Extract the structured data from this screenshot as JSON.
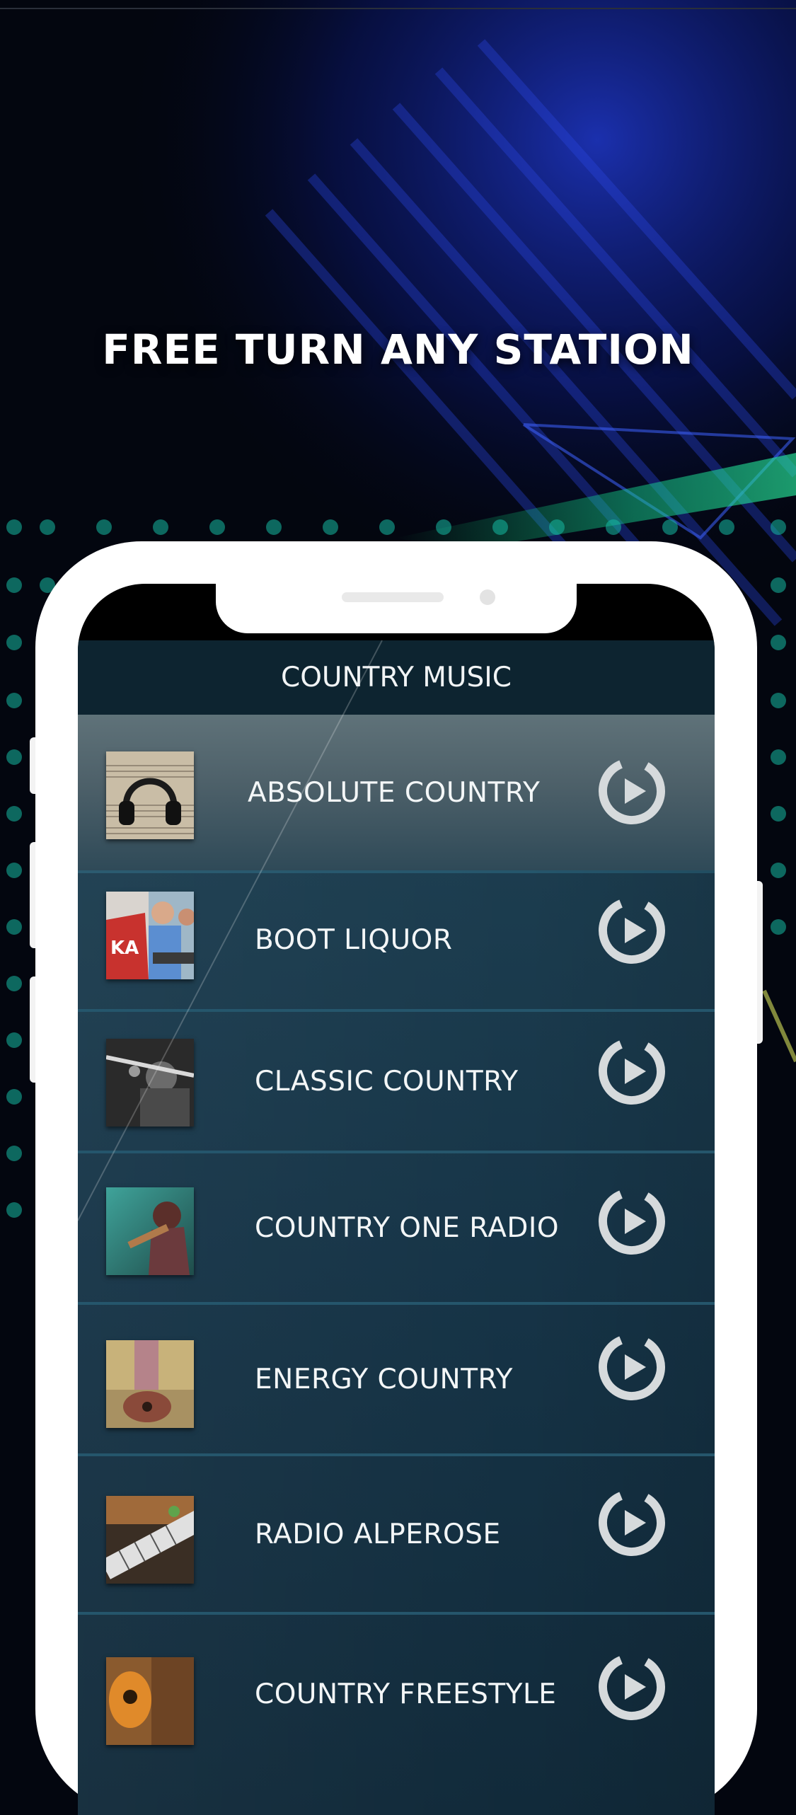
{
  "promo": {
    "headline": "FREE TURN ANY STATION"
  },
  "app": {
    "header_title": "COUNTRY MUSIC",
    "stations": [
      {
        "name": "ABSOLUTE COUNTRY",
        "thumb": "headphones-on-sheet-music"
      },
      {
        "name": "BOOT LIQUOR",
        "thumb": "people-at-stall"
      },
      {
        "name": "CLASSIC COUNTRY",
        "thumb": "flute-player-bw"
      },
      {
        "name": "COUNTRY ONE RADIO",
        "thumb": "woman-with-guitar"
      },
      {
        "name": "ENERGY COUNTRY",
        "thumb": "guitar-in-field"
      },
      {
        "name": "RADIO ALPEROSE",
        "thumb": "guitar-neck-flowers"
      },
      {
        "name": "COUNTRY FREESTYLE",
        "thumb": "acoustic-guitar-wood"
      }
    ],
    "play_icon": "play-circle-icon"
  },
  "colors": {
    "background": "#03060f",
    "accent_blue": "#1d3bd8",
    "accent_green": "#16d18e",
    "header": "#0d2430",
    "list": "#1e4052",
    "divider": "#25566c",
    "play_ring": "#d6dadc"
  }
}
